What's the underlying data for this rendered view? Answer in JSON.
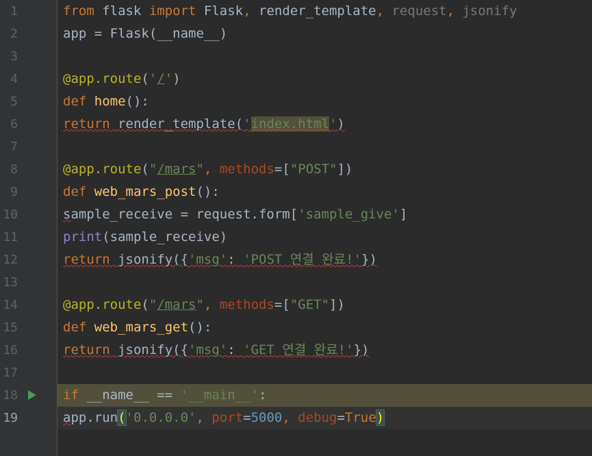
{
  "lines": [
    {
      "number": "1",
      "tokens": [
        [
          "from",
          "kw"
        ],
        [
          " flask ",
          ""
        ],
        [
          "import",
          "kw"
        ],
        [
          " Flask",
          ""
        ],
        [
          ", ",
          "kw"
        ],
        [
          "render_template",
          ""
        ],
        [
          ", ",
          "kw"
        ],
        [
          "request",
          "unused"
        ],
        [
          ", ",
          "kw"
        ],
        [
          "jsonify",
          "unused"
        ]
      ]
    },
    {
      "number": "2",
      "tokens": [
        [
          "app = Flask(__name__)",
          ""
        ]
      ]
    },
    {
      "number": "3",
      "tokens": []
    },
    {
      "number": "4",
      "tokens": [
        [
          "@app.route",
          "dec"
        ],
        [
          "(",
          ""
        ],
        [
          "'",
          "str"
        ],
        [
          "/",
          "str link"
        ],
        [
          "'",
          "str"
        ],
        [
          ")",
          ""
        ]
      ]
    },
    {
      "number": "5",
      "tokens": [
        [
          "def ",
          "kw"
        ],
        [
          "home",
          "fn"
        ],
        [
          "():",
          ""
        ]
      ]
    },
    {
      "number": "6",
      "tokens": [
        [
          "return",
          "kw squig"
        ],
        [
          " render_template(",
          "squig"
        ],
        [
          "'",
          "str squig"
        ],
        [
          "index.html",
          "str squig usage"
        ],
        [
          "'",
          "str squig"
        ],
        [
          ")",
          "squig"
        ]
      ]
    },
    {
      "number": "7",
      "tokens": []
    },
    {
      "number": "8",
      "tokens": [
        [
          "@app.route",
          "dec"
        ],
        [
          "(",
          ""
        ],
        [
          "\"",
          "str"
        ],
        [
          "/mars",
          "str link"
        ],
        [
          "\"",
          "str"
        ],
        [
          ", ",
          "kw"
        ],
        [
          "methods",
          "param"
        ],
        [
          "=[",
          ""
        ],
        [
          "\"POST\"",
          "str"
        ],
        [
          "])",
          ""
        ]
      ]
    },
    {
      "number": "9",
      "tokens": [
        [
          "def ",
          "kw"
        ],
        [
          "web_mars_post",
          "fn"
        ],
        [
          "():",
          ""
        ]
      ]
    },
    {
      "number": "10",
      "tokens": [
        [
          "s",
          "squig"
        ],
        [
          "ample_receive = request.form[",
          ""
        ],
        [
          "'sample_give'",
          "str"
        ],
        [
          "]",
          ""
        ]
      ]
    },
    {
      "number": "11",
      "tokens": [
        [
          "print",
          "builtin"
        ],
        [
          "(sample_receive)",
          ""
        ]
      ]
    },
    {
      "number": "12",
      "tokens": [
        [
          "return",
          "kw squig"
        ],
        [
          " jsonify({",
          "squig"
        ],
        [
          "'msg'",
          "str squig"
        ],
        [
          ": ",
          "squig"
        ],
        [
          "'POST 연결 완료!'",
          "str squig"
        ],
        [
          "})",
          "squig"
        ]
      ]
    },
    {
      "number": "13",
      "tokens": []
    },
    {
      "number": "14",
      "tokens": [
        [
          "@app.route",
          "dec"
        ],
        [
          "(",
          ""
        ],
        [
          "\"",
          "str"
        ],
        [
          "/mars",
          "str link"
        ],
        [
          "\"",
          "str"
        ],
        [
          ", ",
          "kw"
        ],
        [
          "methods",
          "param"
        ],
        [
          "=[",
          ""
        ],
        [
          "\"GET\"",
          "str"
        ],
        [
          "])",
          ""
        ]
      ]
    },
    {
      "number": "15",
      "tokens": [
        [
          "def ",
          "kw"
        ],
        [
          "web_mars_get",
          "fn"
        ],
        [
          "():",
          ""
        ]
      ]
    },
    {
      "number": "16",
      "tokens": [
        [
          "return",
          "kw squig"
        ],
        [
          " jsonify({",
          "squig"
        ],
        [
          "'msg'",
          "str squig"
        ],
        [
          ": ",
          "squig"
        ],
        [
          "'GET 연결 완료!'",
          "str squig"
        ],
        [
          "})",
          "squig"
        ]
      ]
    },
    {
      "number": "17",
      "tokens": []
    },
    {
      "number": "18",
      "tokens": [
        [
          "if",
          "kw"
        ],
        [
          " __name__ == ",
          ""
        ],
        [
          "'__main__'",
          "str"
        ],
        [
          ":",
          ""
        ]
      ],
      "highlight": true,
      "run_icon": true
    },
    {
      "number": "19",
      "tokens": [
        [
          "a",
          "squig"
        ],
        [
          "pp.run",
          ""
        ],
        [
          "(",
          "brace-match"
        ],
        [
          "'0.0.0.0'",
          "str"
        ],
        [
          ", ",
          "kw"
        ],
        [
          "port",
          "param"
        ],
        [
          "=",
          ""
        ],
        [
          "5000",
          "num-lit"
        ],
        [
          ", ",
          "kw"
        ],
        [
          "debug",
          "param"
        ],
        [
          "=",
          ""
        ],
        [
          "True",
          "kw"
        ],
        [
          ")",
          "brace-match"
        ]
      ],
      "current": true
    }
  ],
  "icons": {
    "run": "run-triangle-icon"
  },
  "colors": {
    "background": "#2b2b2b",
    "gutter": "#313335",
    "keyword": "#cc7832",
    "function": "#ffc66d",
    "decorator": "#bbb529",
    "string": "#6a8759",
    "number": "#6897bb",
    "param": "#aa4926",
    "builtin": "#8888c6",
    "text": "#a9b7c6"
  }
}
